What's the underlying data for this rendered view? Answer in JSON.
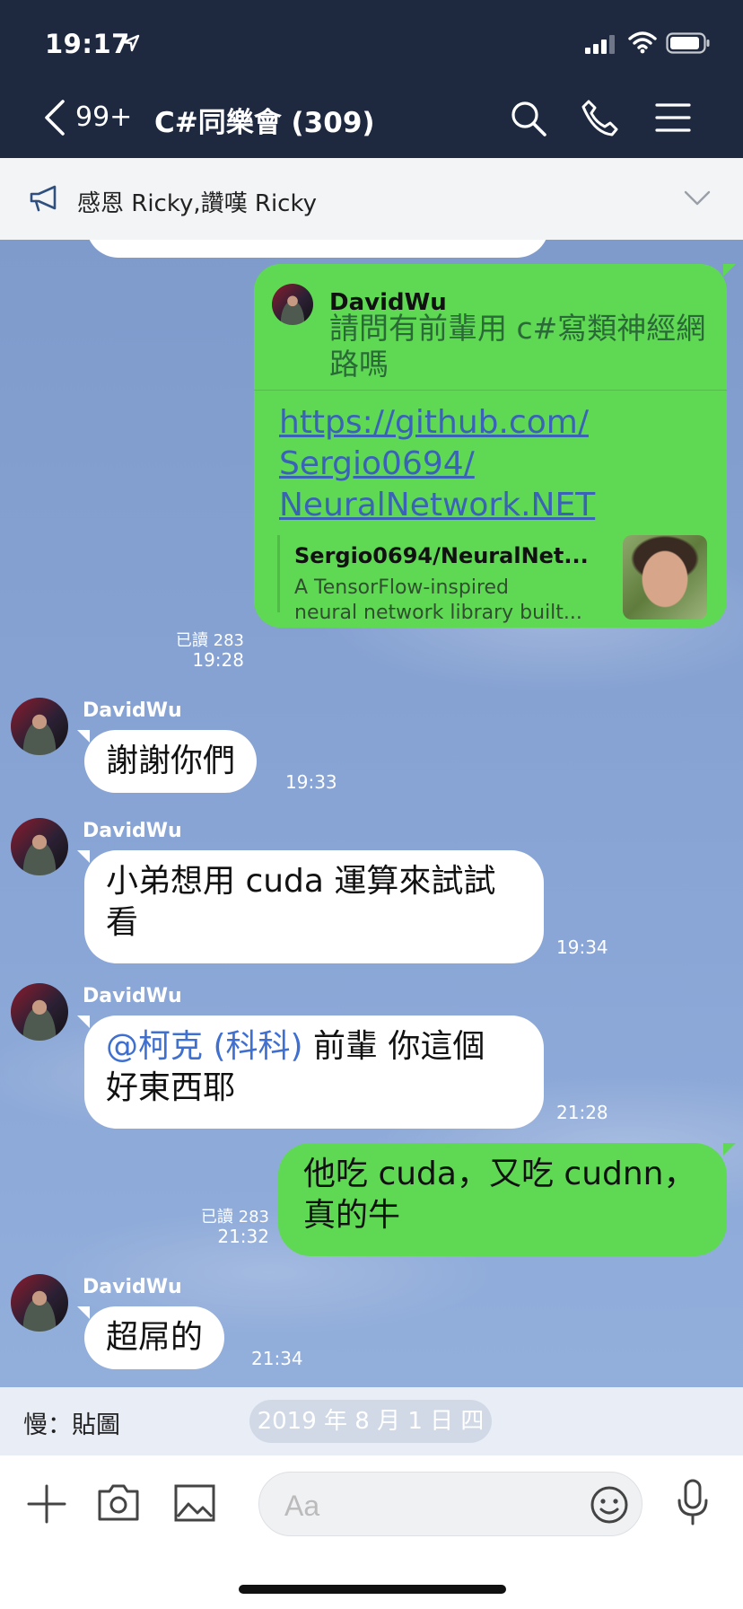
{
  "status_bar": {
    "time": "19:17"
  },
  "header": {
    "back_count": "99+",
    "title": "C#同樂會 (309)"
  },
  "announcement": {
    "text": "感恩 Ricky,讚嘆 Ricky"
  },
  "messages": {
    "m1": {
      "reply_author": "DavidWu",
      "reply_text": "請問有前輩用 c#寫類神經網路嗎",
      "link": "https://github.com/Sergio0694/NeuralNetwork.NET",
      "link_line1": "https://github.com/",
      "link_line2": "Sergio0694/",
      "link_line3": "NeuralNetwork.NET",
      "preview_title": "Sergio0694/NeuralNet...",
      "preview_desc_1": "A TensorFlow-inspired",
      "preview_desc_2": "neural network library built...",
      "read": "已讀 283",
      "time": "19:28"
    },
    "m2": {
      "sender": "DavidWu",
      "text": "謝謝你們",
      "time": "19:33"
    },
    "m3": {
      "sender": "DavidWu",
      "line1": "小弟想用 cuda 運算來試試",
      "line2": "看",
      "time": "19:34"
    },
    "m4": {
      "sender": "DavidWu",
      "mention": "@柯克 (科科)",
      "line1_rest": " 前輩 你這個",
      "line2": "好東西耶",
      "time": "21:28"
    },
    "m5": {
      "line1": "他吃 cuda，又吃 cudnn，",
      "line2": "真的牛",
      "read": "已讀 283",
      "time": "21:32"
    },
    "m6": {
      "sender": "DavidWu",
      "text": "超屌的",
      "time": "21:34"
    }
  },
  "sticker_bar": {
    "label": "慢：貼圖",
    "date": "2019 年 8 月 1 日 四"
  },
  "input": {
    "placeholder": "Aa"
  },
  "colors": {
    "header_bg": "#1e2940",
    "green_bubble": "#5fd954",
    "chat_bg": "#7f9ccd",
    "mention": "#3f6fcf",
    "link": "#3a63b8"
  },
  "icons": [
    "location-arrow-icon",
    "signal-icon",
    "wifi-icon",
    "battery-icon",
    "back-chevron-icon",
    "search-icon",
    "phone-icon",
    "menu-icon",
    "megaphone-icon",
    "chevron-down-icon",
    "plus-icon",
    "camera-icon",
    "image-icon",
    "emoji-icon",
    "microphone-icon"
  ]
}
